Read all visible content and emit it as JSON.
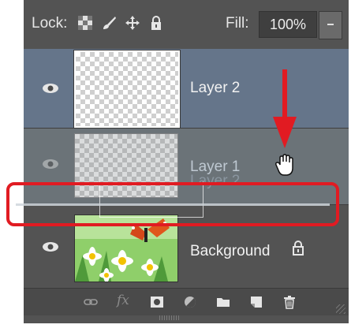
{
  "lockbar": {
    "lock_label": "Lock:",
    "fill_label": "Fill:",
    "fill_value": "100%"
  },
  "layers": [
    {
      "name": "Layer 2",
      "visible": true,
      "selected": true
    },
    {
      "name": "Layer 1",
      "visible": false,
      "selected": false,
      "drag_ghost_name": "Layer 2"
    },
    {
      "name": "Background",
      "visible": true,
      "selected": false,
      "locked": true
    }
  ],
  "toolbar": {
    "icons": [
      "link-icon",
      "fx-icon",
      "mask-icon",
      "adjustment-icon",
      "folder-icon",
      "new-layer-icon",
      "trash-icon"
    ],
    "fx_label": "fx"
  },
  "colors": {
    "panel_bg": "#535353",
    "selected_row": "#65758a",
    "annotation_red": "#e11b22"
  }
}
